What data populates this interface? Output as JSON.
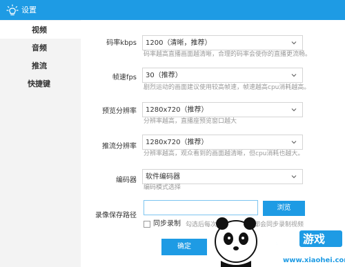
{
  "window": {
    "title": "设置"
  },
  "sidebar": {
    "items": [
      {
        "label": "视频"
      },
      {
        "label": "音频"
      },
      {
        "label": "推流"
      },
      {
        "label": "快捷键"
      }
    ]
  },
  "settings": {
    "bitrate": {
      "label": "码率kbps",
      "value": "1200（清晰，推荐）",
      "hint": "码率越高直播画面越清晰，合理的码率会使你的直播更流畅。"
    },
    "fps": {
      "label": "帧速fps",
      "value": "30（推荐）",
      "hint": "剧烈运动的画面建议使用较高帧速，帧速越高cpu消耗越高。"
    },
    "preview_res": {
      "label": "预览分辨率",
      "value": "1280x720（推荐）",
      "hint": "分辨率越高，直播座预览窗口越大"
    },
    "stream_res": {
      "label": "推流分辨率",
      "value": "1280x720（推荐）",
      "hint": "分辨率越高，观众看到的画面越清晰，但cpu消耗也越大。"
    },
    "encoder": {
      "label": "编码器",
      "value": "软件编码器",
      "hint": "编码模式选择"
    },
    "record_path": {
      "label": "录像保存路径",
      "value": "",
      "browse_label": "浏览"
    },
    "sync_record": {
      "label": "同步录制",
      "hint": "勾选后每次开始推流直播都会同步录制视频"
    }
  },
  "buttons": {
    "ok": "确定"
  },
  "watermark": {
    "brand_text": "小黑游戏",
    "url": "www.xiaohei.com"
  },
  "colors": {
    "accent": "#1e9be4",
    "sidebar_bg": "#f3f3f3",
    "hint": "#999999"
  }
}
